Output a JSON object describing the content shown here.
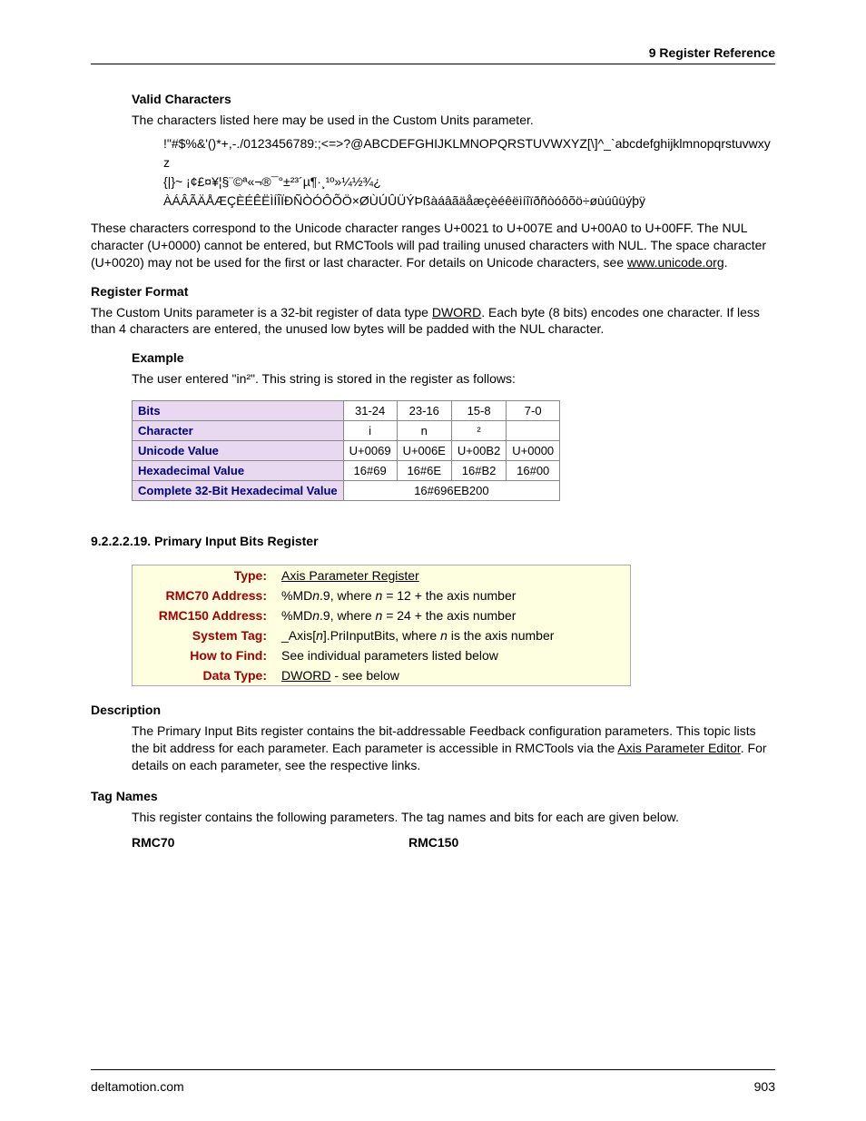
{
  "header": {
    "title": "9  Register Reference"
  },
  "valid_chars": {
    "heading": "Valid Characters",
    "intro": "The characters listed here may be used in the Custom Units parameter.",
    "line1": " !\"#$%&'()*+,-./0123456789:;<=>?@ABCDEFGHIJKLMNOPQRSTUVWXYZ[\\]^_`abcdefghijklmnopqrstuvwxyz",
    "line2": "{|}~ ¡¢£¤¥¦§¨©ª«¬®¯°±²³´µ¶·¸¹º»¼½¾¿",
    "line3": "ÀÁÂÃÄÅÆÇÈÉÊËÌÍÎÏÐÑÒÓÔÕÖ×ØÙÚÛÜÝÞßàáâãäåæçèéêëìíîïðñòóôõö÷øùúûüýþÿ"
  },
  "unicode_note": {
    "text_pre": "These characters correspond to the Unicode character ranges U+0021 to U+007E and U+00A0 to U+00FF. The NUL character (U+0000) cannot be entered, but RMCTools will pad trailing unused characters with NUL. The space character (U+0020) may not be used for the first or last character. For details on Unicode characters, see ",
    "link": "www.unicode.org",
    "text_post": "."
  },
  "reg_format": {
    "heading": "Register Format",
    "text_pre": "The Custom Units parameter is a 32-bit register of data type ",
    "link": "DWORD",
    "text_post": ". Each byte (8 bits) encodes one character. If less than 4 characters are entered, the unused low bytes will be padded with the NUL character."
  },
  "example": {
    "heading": "Example",
    "text": "The user entered \"in²\". This string is stored in the register as follows:"
  },
  "bits_table": {
    "rows": [
      {
        "label": "Bits",
        "cells": [
          "31-24",
          "23-16",
          "15-8",
          "7-0"
        ]
      },
      {
        "label": "Character",
        "cells": [
          "i",
          "n",
          "²",
          ""
        ]
      },
      {
        "label": "Unicode Value",
        "cells": [
          "U+0069",
          "U+006E",
          "U+00B2",
          "U+0000"
        ]
      },
      {
        "label": "Hexadecimal Value",
        "cells": [
          "16#69",
          "16#6E",
          "16#B2",
          "16#00"
        ]
      }
    ],
    "final_label": "Complete 32-Bit Hexadecimal Value",
    "final_value": "16#696EB200"
  },
  "sec19": {
    "number": "9.2.2.2.19. Primary Input Bits Register",
    "info": {
      "type_label": "Type:",
      "type_link": "Axis Parameter Register",
      "rmc70_label": "RMC70 Address:",
      "rmc70_pre": "%MD",
      "rmc70_n": "n",
      "rmc70_post": ".9, where ",
      "rmc70_n2": "n",
      "rmc70_tail": " = 12 + the axis number",
      "rmc150_label": "RMC150 Address:",
      "rmc150_pre": "%MD",
      "rmc150_n": "n",
      "rmc150_post": ".9, where ",
      "rmc150_n2": "n",
      "rmc150_tail": " = 24 + the axis number",
      "systag_label": "System Tag:",
      "systag_pre": "_Axis[",
      "systag_n": "n",
      "systag_mid": "].PriInputBits, where ",
      "systag_n2": "n",
      "systag_tail": " is the axis number",
      "howto_label": "How to Find:",
      "howto_text": "See individual parameters listed below",
      "dtype_label": "Data Type:",
      "dtype_link": "DWORD",
      "dtype_tail": " - see below"
    },
    "desc": {
      "heading": "Description",
      "text_pre": "The Primary Input Bits register contains the bit-addressable Feedback configuration parameters. This topic lists the bit address for each parameter. Each parameter is accessible in RMCTools via the ",
      "link": "Axis Parameter Editor",
      "text_post": ". For details on each parameter, see the respective links."
    },
    "tags": {
      "heading": "Tag Names",
      "text": "This register contains the following parameters. The tag names and bits for each are given below.",
      "col1": "RMC70",
      "col2": "RMC150"
    }
  },
  "footer": {
    "left": "deltamotion.com",
    "right": "903"
  }
}
